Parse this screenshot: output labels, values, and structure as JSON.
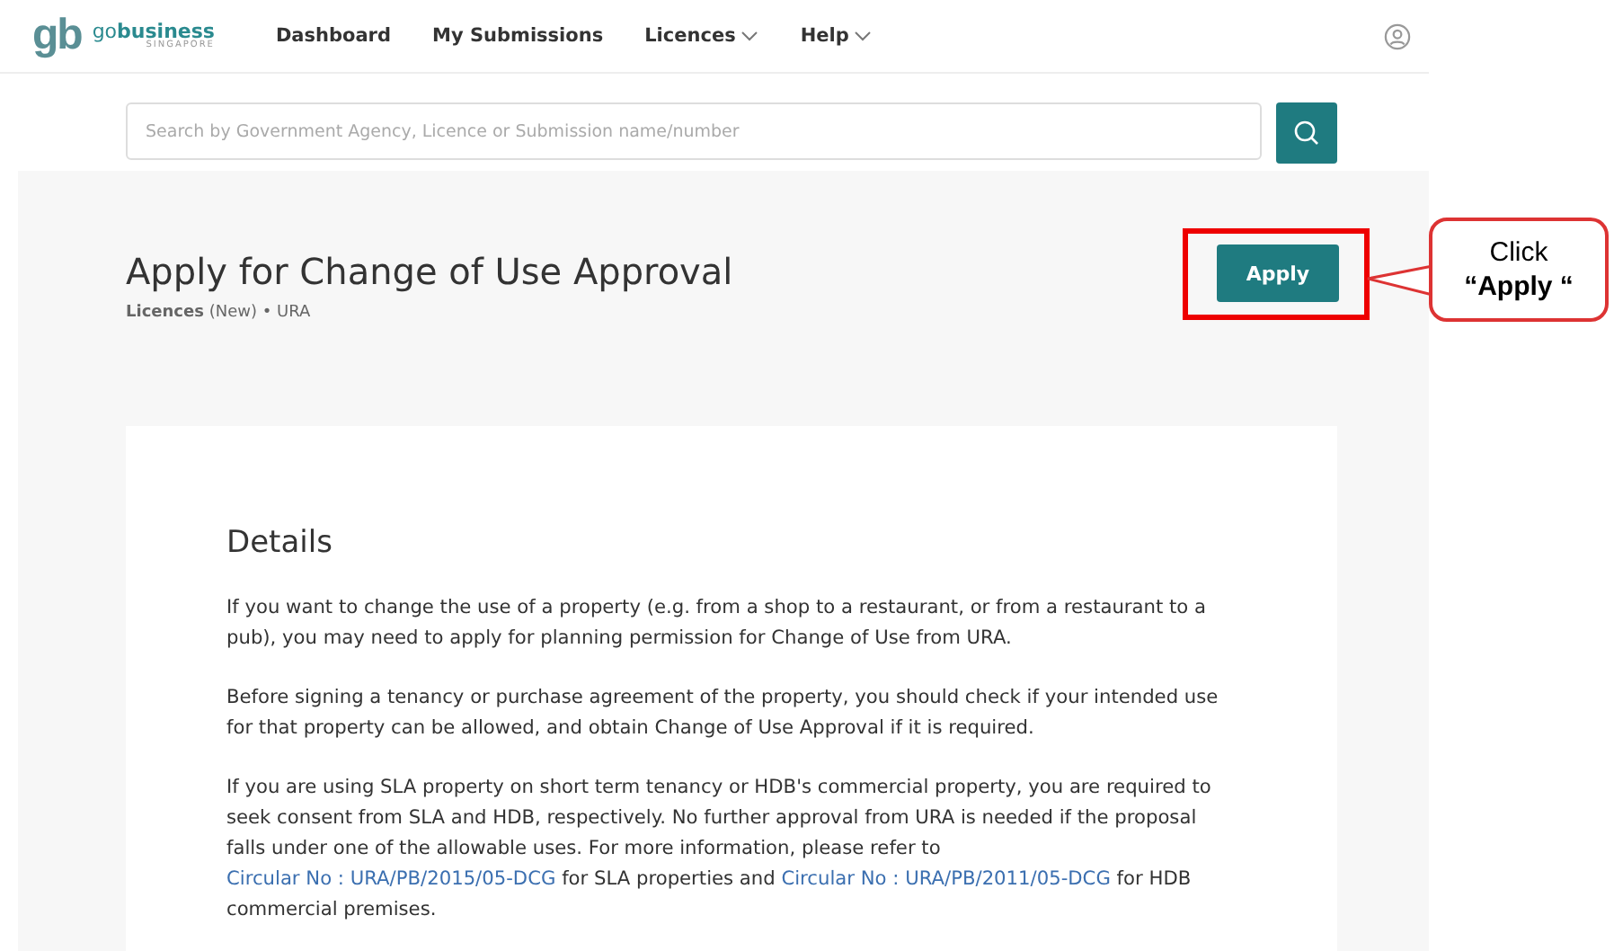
{
  "logo": {
    "mark": "gb",
    "name_prefix": "go",
    "name_bold": "business",
    "tagline": "SINGAPORE"
  },
  "nav": [
    {
      "label": "Dashboard",
      "dropdown": false
    },
    {
      "label": "My Submissions",
      "dropdown": false
    },
    {
      "label": "Licences",
      "dropdown": true
    },
    {
      "label": "Help",
      "dropdown": true
    }
  ],
  "search": {
    "placeholder": "Search by Government Agency, Licence or Submission name/number"
  },
  "page": {
    "title": "Apply for Change of Use Approval",
    "subtitle_bold": "Licences",
    "subtitle_rest": "(New) • URA",
    "apply_button": "Apply"
  },
  "callout": {
    "line1": "Click",
    "line2": "“Apply “"
  },
  "details": {
    "heading": "Details",
    "paragraphs": [
      [
        {
          "text": "If you want to change the use of a property (e.g. from a shop to a restaurant, or from a restaurant to a pub), you may need to apply for planning permission for Change of Use from URA.",
          "link": false
        }
      ],
      [
        {
          "text": "Before signing a tenancy or purchase agreement of the property, you should check if your intended use for that property can be allowed, and obtain Change of Use Approval if it is required.",
          "link": false
        }
      ],
      [
        {
          "text": "If you are using SLA property on short term tenancy or HDB's commercial property, you are required to seek consent from SLA and HDB, respectively. No further approval from URA is needed if the proposal falls under one of the allowable uses. For more information, please refer to ",
          "link": false
        },
        {
          "text": "Circular No : URA/PB/2015/05-DCG",
          "link": true
        },
        {
          "text": " for SLA properties and ",
          "link": false
        },
        {
          "text": "Circular No : URA/PB/2011/05-DCG",
          "link": true
        },
        {
          "text": " for HDB commercial premises.",
          "link": false
        }
      ]
    ]
  }
}
